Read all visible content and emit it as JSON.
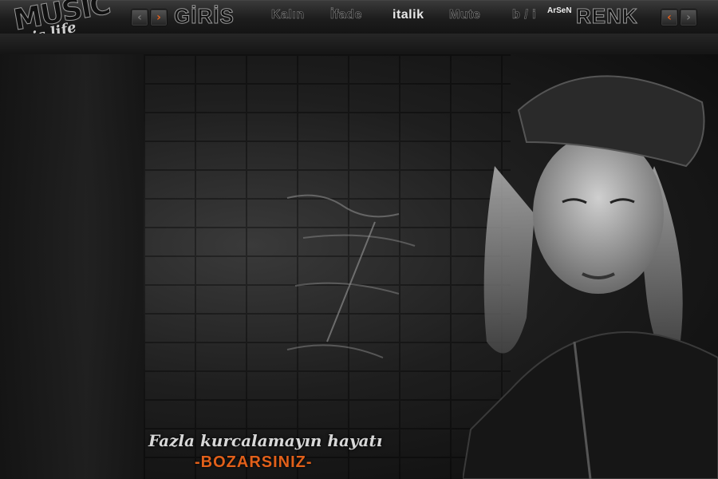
{
  "logo": {
    "main": "MUSIC",
    "sub": "is life"
  },
  "nav": {
    "prev_symbol": "‹",
    "next_symbol": "›"
  },
  "menu": {
    "giris": "GİRİS",
    "kalin": "Kalın",
    "ifade": "İfade",
    "italik": "italik",
    "mute": "Mute",
    "bu": "b / i",
    "renk": "RENK",
    "arsen": "ArSeN"
  },
  "tagline": {
    "prefix": "Fazla ",
    "bold": "kurcalamayın",
    "suffix": " hayatı",
    "line2": "-BOZARSINIZ-"
  },
  "colors": {
    "accent": "#e2601a",
    "text_light": "#d8d8d8",
    "toolbar": "#1d1d1d"
  }
}
